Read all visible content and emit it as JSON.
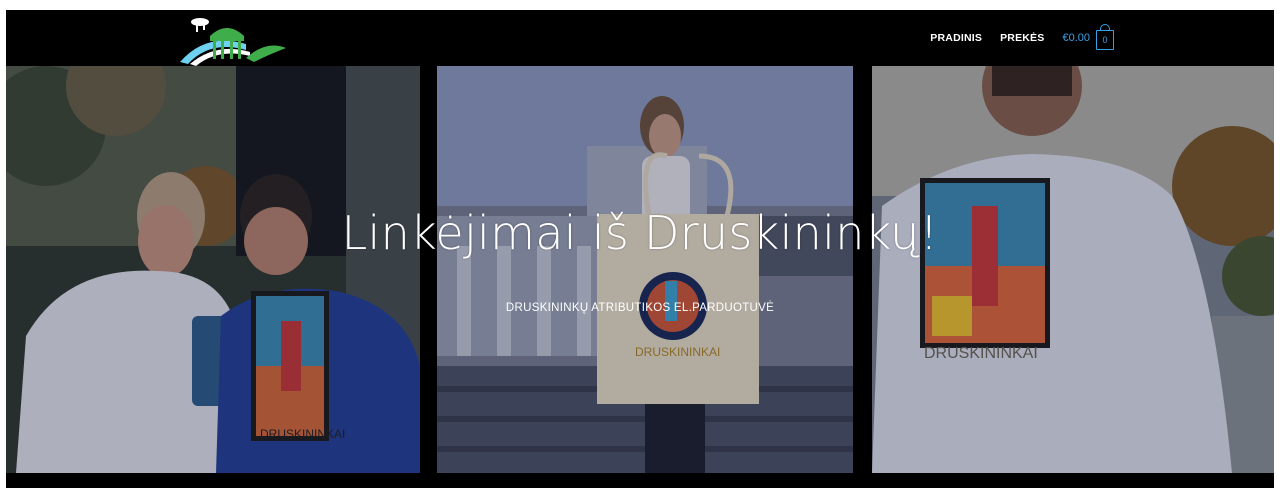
{
  "header": {
    "logo_alt": "Druskininkai",
    "nav": [
      {
        "label": "PRADINIS"
      },
      {
        "label": "PREKĖS"
      }
    ],
    "cart": {
      "total": "€0.00",
      "count": "0"
    }
  },
  "hero": {
    "title": "Linkėjimai iš Druskininkų!",
    "subtitle": "DRUSKININKŲ ATRIBUTIKOS EL.PARDUOTUVĖ",
    "print_text": "DRUSKININKAI"
  },
  "colors": {
    "accent": "#3aa0e6",
    "background": "#000000",
    "text": "#ffffff"
  }
}
